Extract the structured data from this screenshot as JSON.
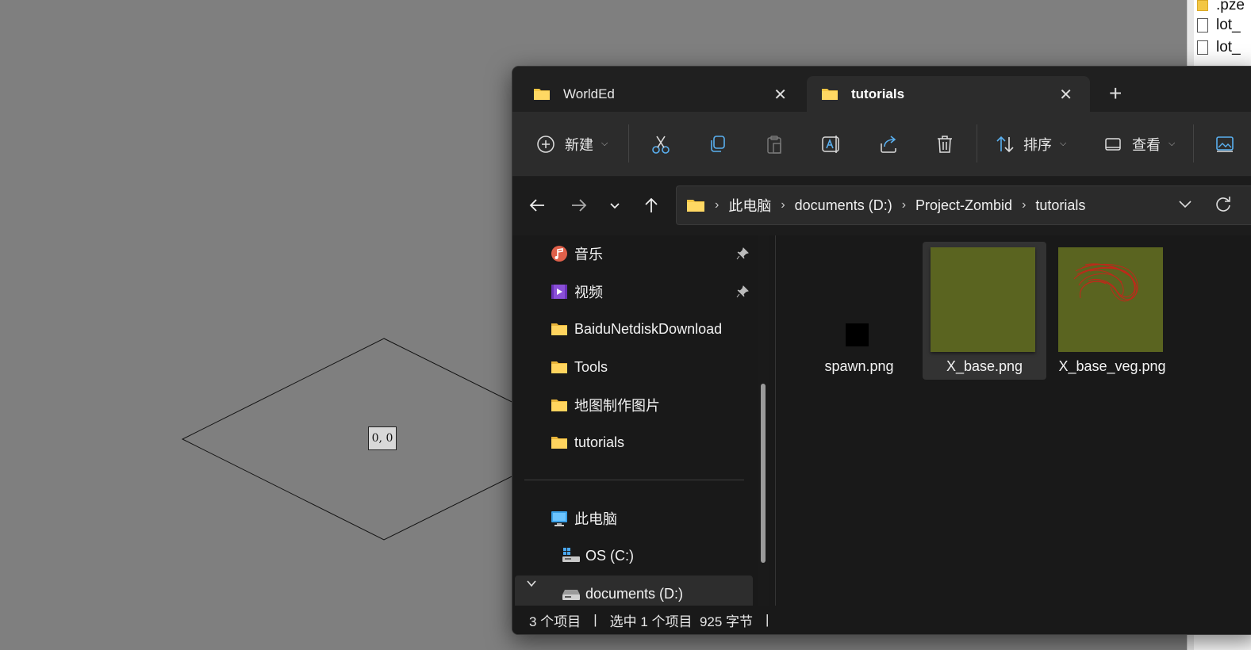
{
  "canvas": {
    "coord_label": "0, 0"
  },
  "background_window": {
    "items": [
      {
        "label": ".pze",
        "icon": "folder-icon"
      },
      {
        "label": "lot_",
        "icon": "file-icon"
      },
      {
        "label": "lot_",
        "icon": "file-icon"
      }
    ]
  },
  "explorer": {
    "tabs": [
      {
        "label": "WorldEd",
        "active": false
      },
      {
        "label": "tutorials",
        "active": true
      }
    ],
    "toolbar": {
      "new_label": "新建",
      "sort_label": "排序",
      "view_label": "查看"
    },
    "address": {
      "crumbs": [
        "此电脑",
        "documents (D:)",
        "Project-Zombid",
        "tutorials"
      ]
    },
    "nav_pane": {
      "quick_access": [
        {
          "label": "音乐",
          "icon": "music-icon",
          "pinned": true
        },
        {
          "label": "视频",
          "icon": "video-icon",
          "pinned": true
        },
        {
          "label": "BaiduNetdiskDownload",
          "icon": "folder-icon",
          "pinned": false
        },
        {
          "label": "Tools",
          "icon": "folder-icon",
          "pinned": false
        },
        {
          "label": "地图制作图片",
          "icon": "folder-icon",
          "pinned": false
        },
        {
          "label": "tutorials",
          "icon": "folder-icon",
          "pinned": false
        }
      ],
      "this_pc": "此电脑",
      "drives": [
        {
          "label": "OS (C:)",
          "icon": "os-drive-icon"
        },
        {
          "label": "documents (D:)",
          "icon": "drive-icon",
          "selected": true
        }
      ]
    },
    "files": [
      {
        "name": "spawn.png",
        "thumb": "black",
        "selected": false
      },
      {
        "name": "X_base.png",
        "thumb": "olive",
        "selected": true
      },
      {
        "name": "X_base_veg.png",
        "thumb": "olive-red-scribble",
        "selected": false
      }
    ],
    "status": {
      "count": "3 个项目",
      "selection": "选中 1 个项目  925 字节"
    },
    "colors": {
      "olive": "#5a6420",
      "scribble": "#c0281a",
      "folder": "#f4c542"
    }
  }
}
